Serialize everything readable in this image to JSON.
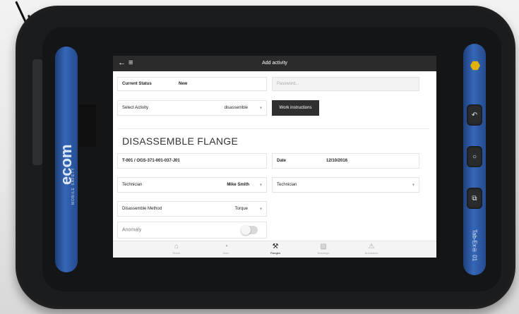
{
  "device": {
    "brand": "ecom",
    "brand_sub": "MOBILE SAFETY",
    "model": "Tab-Ex® 01",
    "hw_buttons": [
      {
        "name": "back-hardware-button",
        "glyph": "↶"
      },
      {
        "name": "home-hardware-button",
        "glyph": "○"
      },
      {
        "name": "apps-hardware-button",
        "glyph": "⧉"
      }
    ],
    "accent_blue": "#2f60b0"
  },
  "appbar": {
    "back_icon": "←",
    "menu_icon": "≡",
    "title": "Add activity"
  },
  "form": {
    "current_status": {
      "label": "Current Status",
      "value": "New"
    },
    "password": {
      "placeholder": "Password..."
    },
    "select_activity": {
      "label": "Select Activity",
      "value": "disassemble"
    },
    "work_instructions_label": "Work instructions",
    "section_title": "DISASSEMBLE FLANGE",
    "tag": {
      "value": "T-001 / OGS-371-001-037-J01"
    },
    "date": {
      "label": "Date",
      "value": "12/10/2016"
    },
    "technician_1": {
      "label": "Technician",
      "value": "Mike Smith"
    },
    "technician_2": {
      "label": "Technician",
      "value": ""
    },
    "disassemble_method": {
      "label": "Disassemble Method",
      "value": "Torque"
    },
    "anomaly": {
      "label": "Anomaly",
      "enabled": false
    }
  },
  "caret_glyph": "▾",
  "bottom_nav": [
    {
      "label": "Home",
      "icon": "⌂",
      "active": false
    },
    {
      "label": "Scan",
      "icon": "◔",
      "active": false
    },
    {
      "label": "Flanges",
      "icon": "⚒",
      "active": true
    },
    {
      "label": "Drawings",
      "icon": "▨",
      "active": false
    },
    {
      "label": "Anomalies",
      "icon": "⚠",
      "active": false
    }
  ]
}
